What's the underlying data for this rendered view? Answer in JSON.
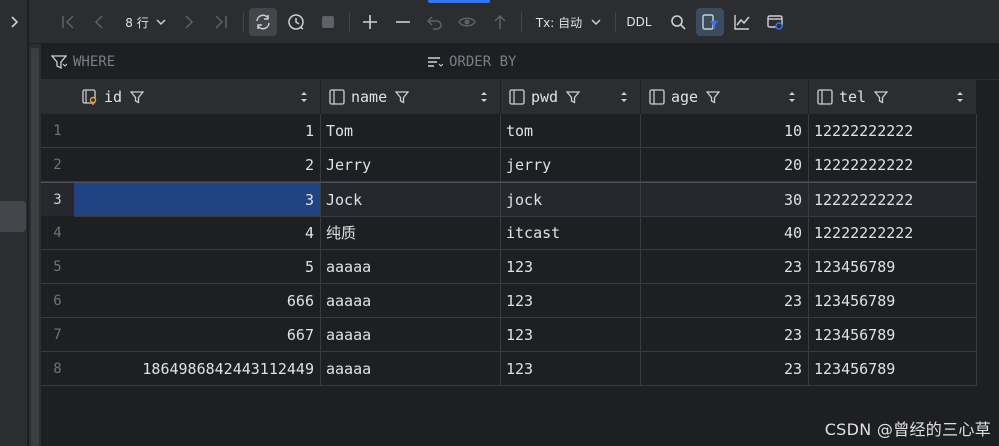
{
  "toolbar": {
    "row_count_label": "8 行",
    "tx_label": "Tx: 自动",
    "ddl_label": "DDL"
  },
  "filter": {
    "where_label": "WHERE",
    "order_by_label": "ORDER BY"
  },
  "columns": [
    {
      "name": "id",
      "icon": "key-column-icon"
    },
    {
      "name": "name",
      "icon": "column-icon"
    },
    {
      "name": "pwd",
      "icon": "column-icon"
    },
    {
      "name": "age",
      "icon": "column-icon"
    },
    {
      "name": "tel",
      "icon": "column-icon"
    }
  ],
  "rows": [
    {
      "num": "1",
      "id": "1",
      "name": "Tom",
      "pwd": "tom",
      "age": "10",
      "tel": "12222222222"
    },
    {
      "num": "2",
      "id": "2",
      "name": "Jerry",
      "pwd": "jerry",
      "age": "20",
      "tel": "12222222222"
    },
    {
      "num": "3",
      "id": "3",
      "name": "Jock",
      "pwd": "jock",
      "age": "30",
      "tel": "12222222222"
    },
    {
      "num": "4",
      "id": "4",
      "name": "纯质",
      "pwd": "itcast",
      "age": "40",
      "tel": "12222222222"
    },
    {
      "num": "5",
      "id": "5",
      "name": "aaaaa",
      "pwd": "123",
      "age": "23",
      "tel": "123456789"
    },
    {
      "num": "6",
      "id": "666",
      "name": "aaaaa",
      "pwd": "123",
      "age": "23",
      "tel": "123456789"
    },
    {
      "num": "7",
      "id": "667",
      "name": "aaaaa",
      "pwd": "123",
      "age": "23",
      "tel": "123456789"
    },
    {
      "num": "8",
      "id": "1864986842443112449",
      "name": "aaaaa",
      "pwd": "123",
      "age": "23",
      "tel": "123456789"
    }
  ],
  "selection": {
    "row": 3,
    "column": "id"
  },
  "watermark": "CSDN @曾经的三心草",
  "colors": {
    "background": "#1e1f22",
    "toolbar": "#2b2d30",
    "selection": "#214283",
    "accent": "#3574f0"
  }
}
